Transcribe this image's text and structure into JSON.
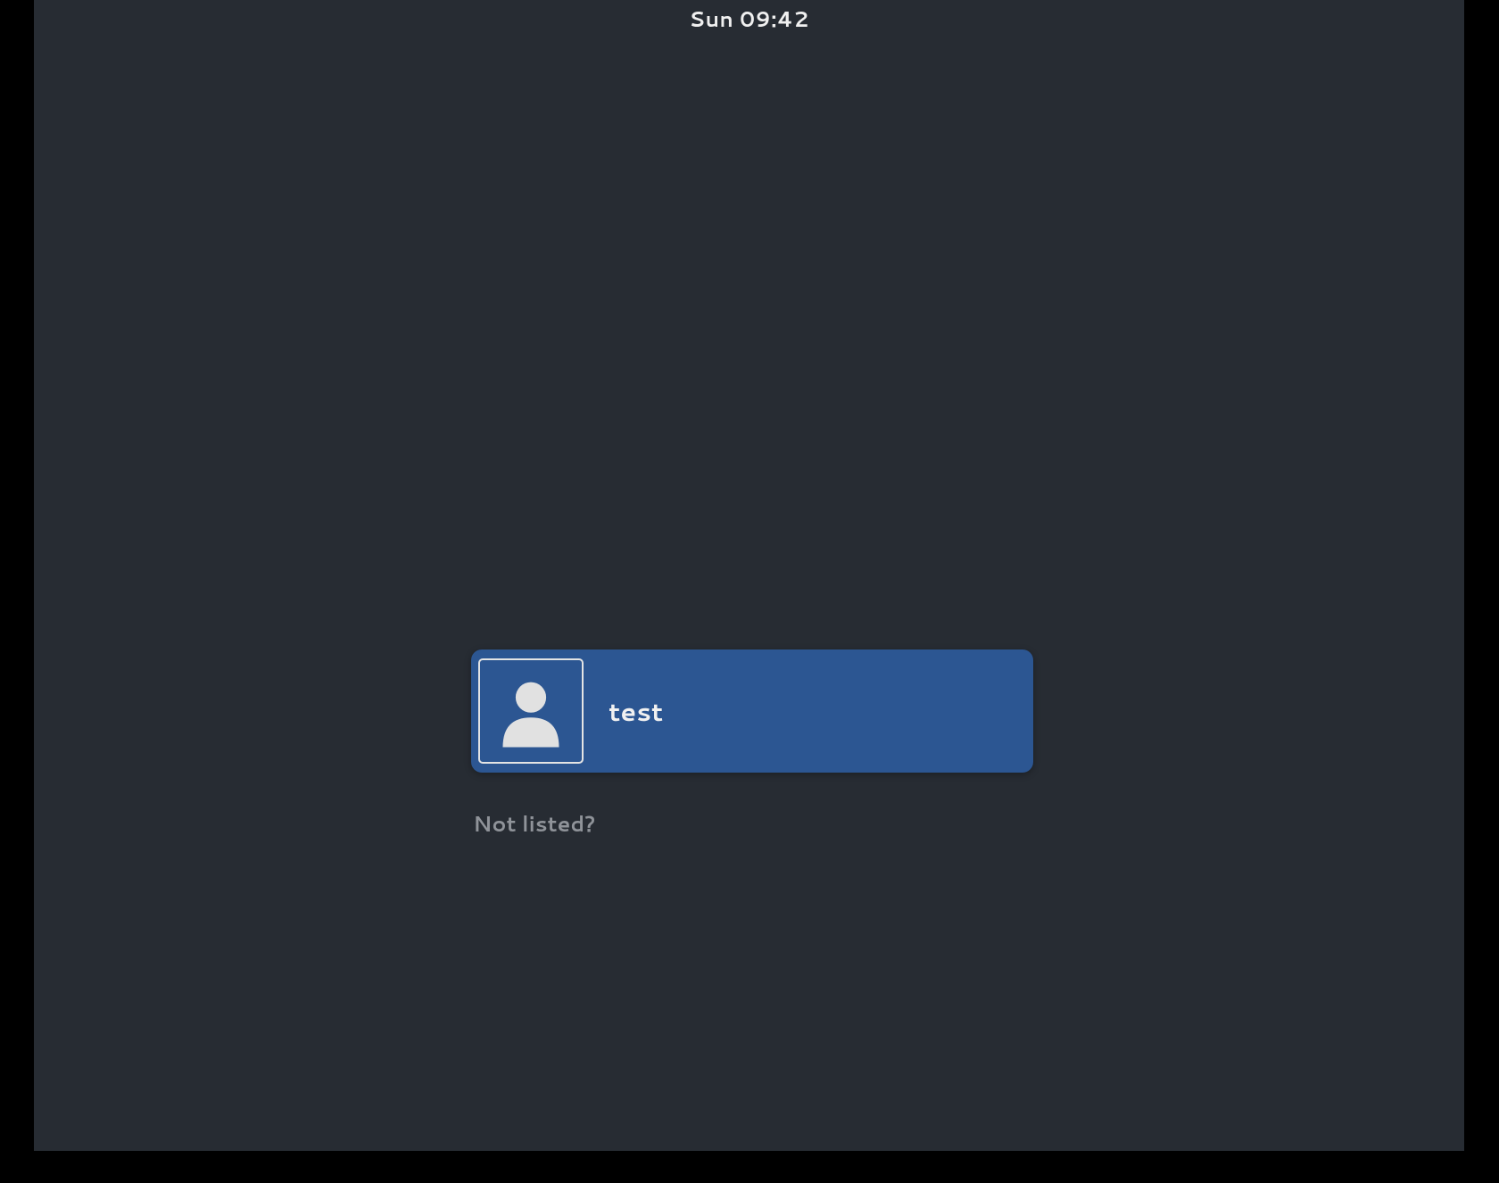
{
  "topbar": {
    "clock": "Sun 09:42"
  },
  "login": {
    "users": [
      {
        "name": "test"
      }
    ],
    "not_listed_label": "Not listed?"
  },
  "colors": {
    "background_outer": "#000000",
    "background_desktop": "#272c33",
    "user_item_bg": "#2c5692",
    "text_primary": "#f1f1f1",
    "text_muted": "#8f9399",
    "avatar_border": "#e4e4e4"
  }
}
